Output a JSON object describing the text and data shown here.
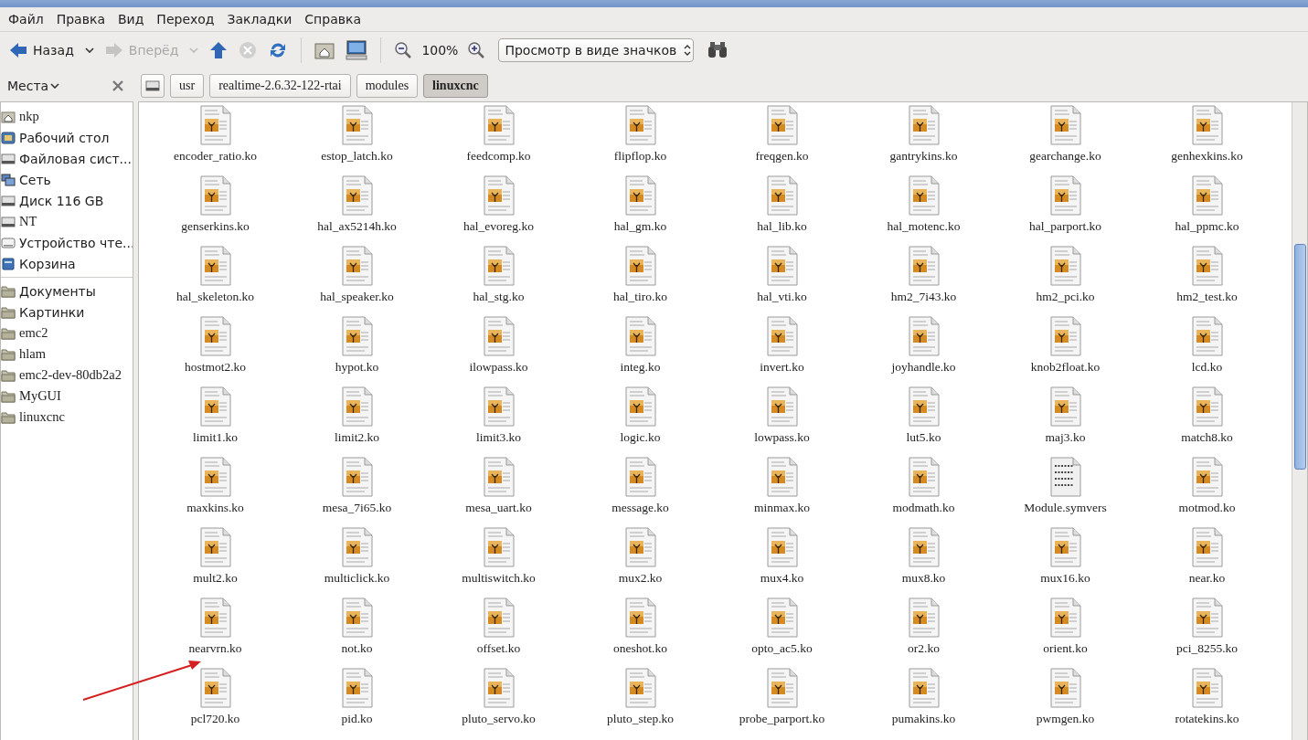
{
  "menu": [
    "Файл",
    "Правка",
    "Вид",
    "Переход",
    "Закладки",
    "Справка"
  ],
  "toolbar": {
    "back": {
      "label": "Назад",
      "disabled": false
    },
    "forward": {
      "label": "Вперёд",
      "disabled": true
    },
    "stop_disabled": true,
    "zoom": "100%",
    "view": "Просмотр в виде значков"
  },
  "sidebar": {
    "title": "Места",
    "places": [
      {
        "label": "nkp",
        "kind": "home"
      },
      {
        "label": "Рабочий стол",
        "kind": "desktop"
      },
      {
        "label": "Файловая сист...",
        "kind": "drive"
      },
      {
        "label": "Сеть",
        "kind": "network"
      },
      {
        "label": "Диск 116 GB",
        "kind": "drive"
      },
      {
        "label": "NT",
        "kind": "drive"
      },
      {
        "label": "Устройство чте...",
        "kind": "optical"
      },
      {
        "label": "Корзина",
        "kind": "trash"
      }
    ],
    "bookmarks": [
      {
        "label": "Документы",
        "kind": "folder"
      },
      {
        "label": "Картинки",
        "kind": "folder"
      },
      {
        "label": "emc2",
        "kind": "folder"
      },
      {
        "label": "hlam",
        "kind": "folder"
      },
      {
        "label": "emc2-dev-80db2a2",
        "kind": "folder"
      },
      {
        "label": "MyGUI",
        "kind": "folder"
      },
      {
        "label": "linuxcnc",
        "kind": "folder"
      }
    ]
  },
  "path": [
    {
      "label": "usr",
      "selected": false
    },
    {
      "label": "realtime-2.6.32-122-rtai",
      "selected": false
    },
    {
      "label": "modules",
      "selected": false
    },
    {
      "label": "linuxcnc",
      "selected": true
    }
  ],
  "files": [
    {
      "name": "encoder_ratio.ko",
      "kind": "module"
    },
    {
      "name": "estop_latch.ko",
      "kind": "module"
    },
    {
      "name": "feedcomp.ko",
      "kind": "module"
    },
    {
      "name": "flipflop.ko",
      "kind": "module"
    },
    {
      "name": "freqgen.ko",
      "kind": "module"
    },
    {
      "name": "gantrykins.ko",
      "kind": "module"
    },
    {
      "name": "gearchange.ko",
      "kind": "module"
    },
    {
      "name": "genhexkins.ko",
      "kind": "module"
    },
    {
      "name": "genserkins.ko",
      "kind": "module"
    },
    {
      "name": "hal_ax5214h.ko",
      "kind": "module"
    },
    {
      "name": "hal_evoreg.ko",
      "kind": "module"
    },
    {
      "name": "hal_gm.ko",
      "kind": "module"
    },
    {
      "name": "hal_lib.ko",
      "kind": "module"
    },
    {
      "name": "hal_motenc.ko",
      "kind": "module"
    },
    {
      "name": "hal_parport.ko",
      "kind": "module"
    },
    {
      "name": "hal_ppmc.ko",
      "kind": "module"
    },
    {
      "name": "hal_skeleton.ko",
      "kind": "module"
    },
    {
      "name": "hal_speaker.ko",
      "kind": "module"
    },
    {
      "name": "hal_stg.ko",
      "kind": "module"
    },
    {
      "name": "hal_tiro.ko",
      "kind": "module"
    },
    {
      "name": "hal_vti.ko",
      "kind": "module"
    },
    {
      "name": "hm2_7i43.ko",
      "kind": "module"
    },
    {
      "name": "hm2_pci.ko",
      "kind": "module"
    },
    {
      "name": "hm2_test.ko",
      "kind": "module"
    },
    {
      "name": "hostmot2.ko",
      "kind": "module"
    },
    {
      "name": "hypot.ko",
      "kind": "module"
    },
    {
      "name": "ilowpass.ko",
      "kind": "module"
    },
    {
      "name": "integ.ko",
      "kind": "module"
    },
    {
      "name": "invert.ko",
      "kind": "module"
    },
    {
      "name": "joyhandle.ko",
      "kind": "module"
    },
    {
      "name": "knob2float.ko",
      "kind": "module"
    },
    {
      "name": "lcd.ko",
      "kind": "module"
    },
    {
      "name": "limit1.ko",
      "kind": "module"
    },
    {
      "name": "limit2.ko",
      "kind": "module"
    },
    {
      "name": "limit3.ko",
      "kind": "module"
    },
    {
      "name": "logic.ko",
      "kind": "module"
    },
    {
      "name": "lowpass.ko",
      "kind": "module"
    },
    {
      "name": "lut5.ko",
      "kind": "module"
    },
    {
      "name": "maj3.ko",
      "kind": "module"
    },
    {
      "name": "match8.ko",
      "kind": "module"
    },
    {
      "name": "maxkins.ko",
      "kind": "module"
    },
    {
      "name": "mesa_7i65.ko",
      "kind": "module"
    },
    {
      "name": "mesa_uart.ko",
      "kind": "module"
    },
    {
      "name": "message.ko",
      "kind": "module"
    },
    {
      "name": "minmax.ko",
      "kind": "module"
    },
    {
      "name": "modmath.ko",
      "kind": "module"
    },
    {
      "name": "Module.symvers",
      "kind": "hex"
    },
    {
      "name": "motmod.ko",
      "kind": "module"
    },
    {
      "name": "mult2.ko",
      "kind": "module"
    },
    {
      "name": "multiclick.ko",
      "kind": "module"
    },
    {
      "name": "multiswitch.ko",
      "kind": "module"
    },
    {
      "name": "mux2.ko",
      "kind": "module"
    },
    {
      "name": "mux4.ko",
      "kind": "module"
    },
    {
      "name": "mux8.ko",
      "kind": "module"
    },
    {
      "name": "mux16.ko",
      "kind": "module"
    },
    {
      "name": "near.ko",
      "kind": "module"
    },
    {
      "name": "nearvrn.ko",
      "kind": "module"
    },
    {
      "name": "not.ko",
      "kind": "module"
    },
    {
      "name": "offset.ko",
      "kind": "module"
    },
    {
      "name": "oneshot.ko",
      "kind": "module"
    },
    {
      "name": "opto_ac5.ko",
      "kind": "module"
    },
    {
      "name": "or2.ko",
      "kind": "module"
    },
    {
      "name": "orient.ko",
      "kind": "module"
    },
    {
      "name": "pci_8255.ko",
      "kind": "module"
    },
    {
      "name": "pcl720.ko",
      "kind": "module"
    },
    {
      "name": "pid.ko",
      "kind": "module"
    },
    {
      "name": "pluto_servo.ko",
      "kind": "module"
    },
    {
      "name": "pluto_step.ko",
      "kind": "module"
    },
    {
      "name": "probe_parport.ko",
      "kind": "module"
    },
    {
      "name": "pumakins.ko",
      "kind": "module"
    },
    {
      "name": "pwmgen.ko",
      "kind": "module"
    },
    {
      "name": "rotatekins.ko",
      "kind": "module"
    }
  ]
}
